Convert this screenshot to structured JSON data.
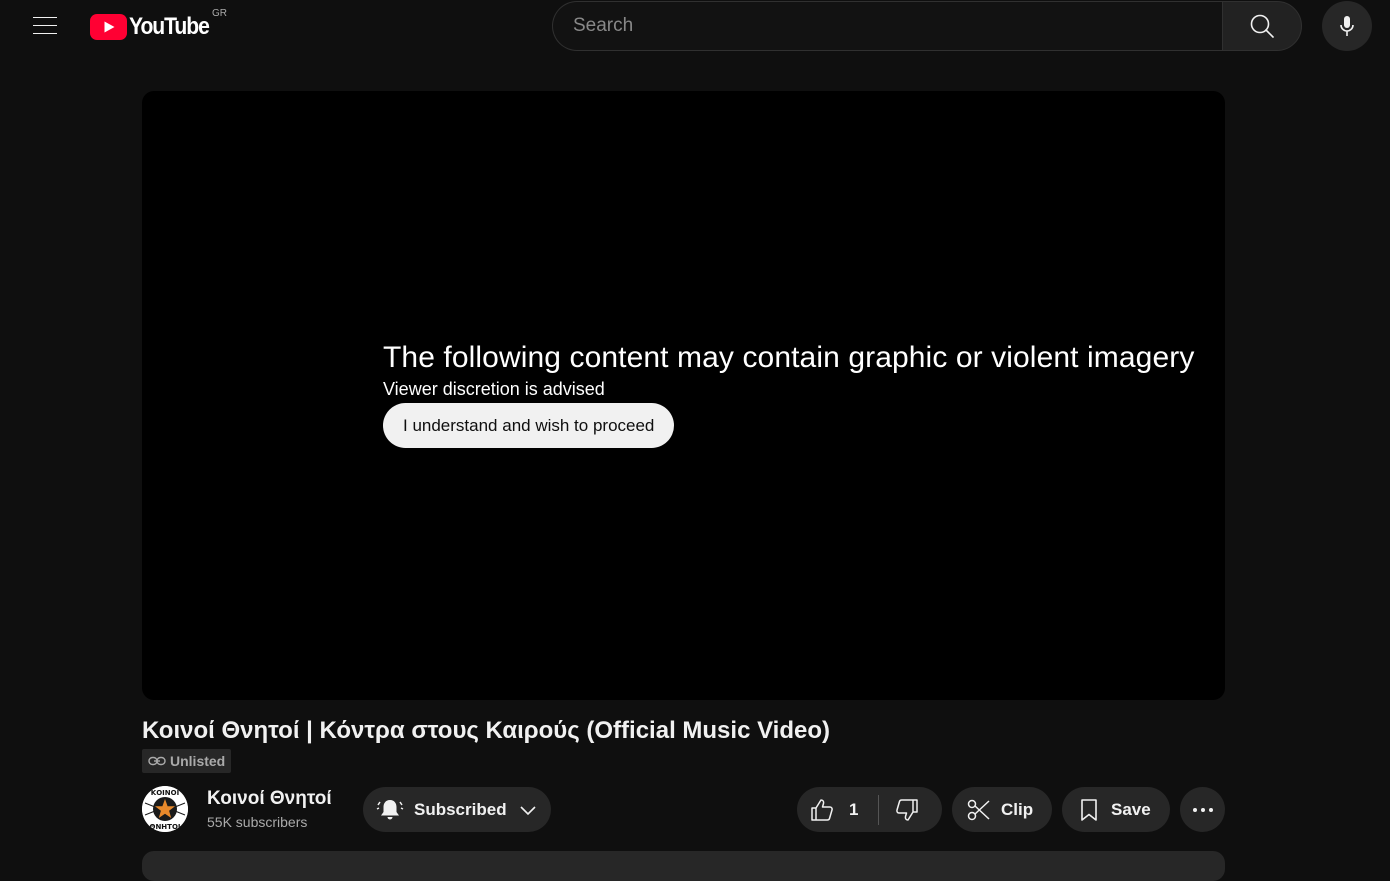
{
  "masthead": {
    "logo_text": "YouTube",
    "country_code": "GR",
    "search_placeholder": "Search",
    "icons": [
      "menu-icon",
      "search-icon",
      "mic-icon"
    ]
  },
  "player": {
    "warning_title": "The following content may contain graphic or violent imagery",
    "warning_subtitle": "Viewer discretion is advised",
    "proceed_label": "I understand and wish to proceed"
  },
  "video": {
    "title": "Κοινοί Θνητοί | Κόντρα στους Καιρούς (Official Music Video)",
    "visibility_badge": "Unlisted"
  },
  "channel": {
    "avatar_text_top": "ΚΟΙΝΟΙ",
    "avatar_text_bottom": "ΘΝΗΤΟΙ",
    "name": "Κοινοί Θνητοί",
    "subscribers": "55K subscribers",
    "subscribe_label": "Subscribed"
  },
  "actions": {
    "like_count": "1",
    "clip_label": "Clip",
    "save_label": "Save"
  },
  "colors": {
    "background": "#0f0f0f",
    "surface": "#272727",
    "brand_red": "#ff0033",
    "text_primary": "#f1f1f1",
    "text_secondary": "#aaaaaa"
  }
}
